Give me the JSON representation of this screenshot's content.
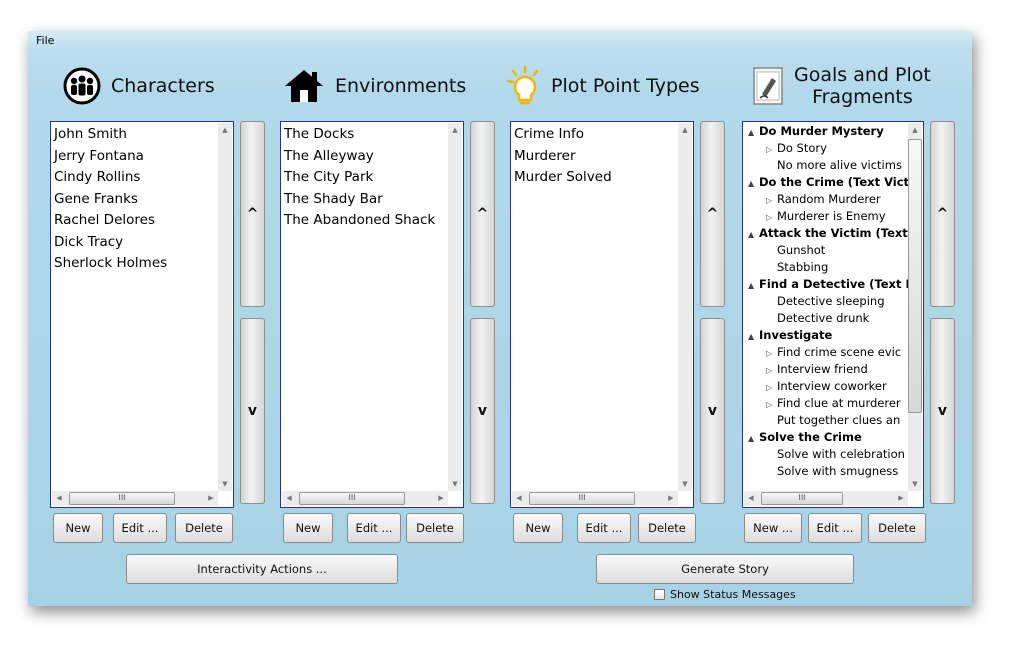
{
  "menu": {
    "file": "File"
  },
  "columns": [
    {
      "title": "Characters",
      "icon": "people-icon",
      "items": [
        "John Smith",
        "Jerry Fontana",
        "Cindy Rollins",
        "Gene Franks",
        "Rachel Delores",
        "Dick Tracy",
        "Sherlock Holmes"
      ],
      "buttons": [
        "New",
        "Edit ...",
        "Delete"
      ]
    },
    {
      "title": "Environments",
      "icon": "house-icon",
      "items": [
        "The Docks",
        "The Alleyway",
        "The City Park",
        "The Shady Bar",
        "The Abandoned Shack"
      ],
      "buttons": [
        "New",
        "Edit ...",
        "Delete"
      ]
    },
    {
      "title": "Plot Point Types",
      "icon": "lightbulb-icon",
      "items": [
        "Crime Info",
        "Murderer",
        "Murder Solved"
      ],
      "buttons": [
        "New",
        "Edit ...",
        "Delete"
      ]
    },
    {
      "title_line1": "Goals and Plot",
      "title_line2": "Fragments",
      "icon": "document-pen-icon",
      "buttons": [
        "New ...",
        "Edit ...",
        "Delete"
      ]
    }
  ],
  "tree": [
    {
      "text": "Do Murder Mystery",
      "level": 0,
      "glyph": "▲",
      "bold": true
    },
    {
      "text": "Do Story",
      "level": 1,
      "glyph": "▷",
      "bold": false
    },
    {
      "text": "No more alive victims",
      "level": 1,
      "glyph": "",
      "bold": false
    },
    {
      "text": "Do the Crime (Text Victi",
      "level": 0,
      "glyph": "▲",
      "bold": true
    },
    {
      "text": "Random Murderer",
      "level": 1,
      "glyph": "▷",
      "bold": false
    },
    {
      "text": "Murderer is Enemy",
      "level": 1,
      "glyph": "▷",
      "bold": false
    },
    {
      "text": "Attack the Victim (Text",
      "level": 0,
      "glyph": "▲",
      "bold": true
    },
    {
      "text": "Gunshot",
      "level": 1,
      "glyph": "",
      "bold": false
    },
    {
      "text": "Stabbing",
      "level": 1,
      "glyph": "",
      "bold": false
    },
    {
      "text": "Find a Detective (Text D",
      "level": 0,
      "glyph": "▲",
      "bold": true
    },
    {
      "text": "Detective sleeping",
      "level": 1,
      "glyph": "",
      "bold": false
    },
    {
      "text": "Detective drunk",
      "level": 1,
      "glyph": "",
      "bold": false
    },
    {
      "text": "Investigate",
      "level": 0,
      "glyph": "▲",
      "bold": true
    },
    {
      "text": "Find crime scene evic",
      "level": 1,
      "glyph": "▷",
      "bold": false
    },
    {
      "text": "Interview friend",
      "level": 1,
      "glyph": "▷",
      "bold": false
    },
    {
      "text": "Interview coworker",
      "level": 1,
      "glyph": "▷",
      "bold": false
    },
    {
      "text": "Find clue at murderer",
      "level": 1,
      "glyph": "▷",
      "bold": false
    },
    {
      "text": "Put together clues an",
      "level": 1,
      "glyph": "",
      "bold": false
    },
    {
      "text": "Solve the Crime",
      "level": 0,
      "glyph": "▲",
      "bold": true
    },
    {
      "text": "Solve with celebration",
      "level": 1,
      "glyph": "",
      "bold": false
    },
    {
      "text": "Solve with smugness",
      "level": 1,
      "glyph": "",
      "bold": false
    }
  ],
  "updown": {
    "up": "^",
    "down": "v"
  },
  "actions": {
    "interactivity": "Interactivity Actions ...",
    "generate": "Generate Story"
  },
  "status_checkbox": {
    "label": "Show Status Messages",
    "checked": false
  },
  "scroll_glyphs": {
    "up": "▲",
    "down": "▼",
    "left": "◀",
    "right": "▶",
    "grip": "III"
  }
}
